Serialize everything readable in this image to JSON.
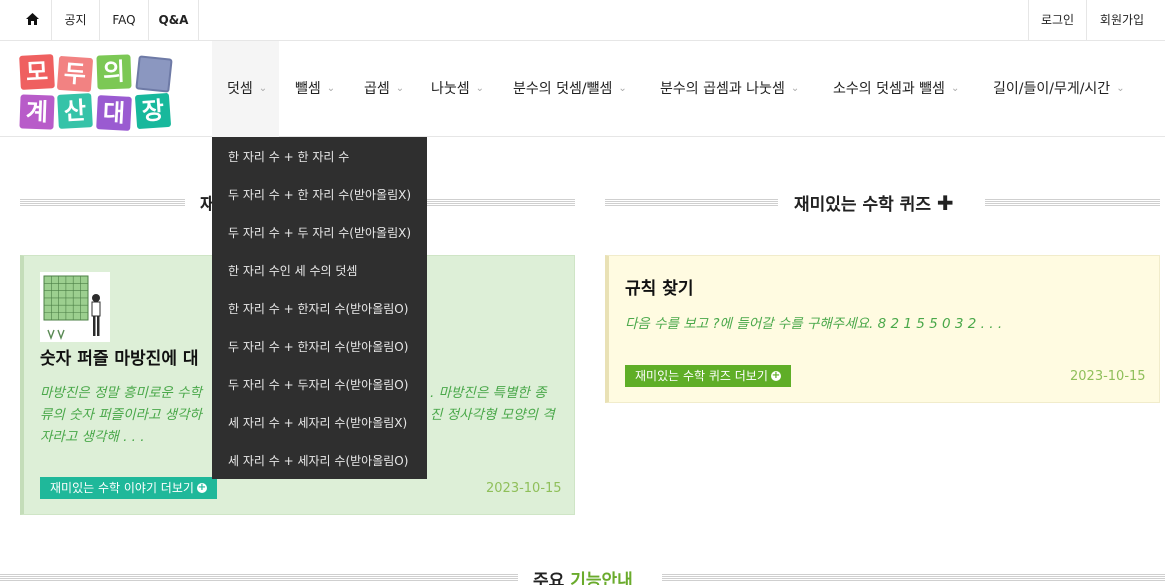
{
  "topbar": {
    "home_icon": "home-icon",
    "notice": "공지",
    "faq": "FAQ",
    "qna": "Q&A",
    "login": "로그인",
    "signup": "회원가입"
  },
  "logo": {
    "tiles": [
      "모",
      "두",
      "의",
      "",
      "계",
      "산",
      "대",
      "장"
    ]
  },
  "nav": {
    "items": [
      {
        "label": "덧셈"
      },
      {
        "label": "뺄셈"
      },
      {
        "label": "곱셈"
      },
      {
        "label": "나눗셈"
      },
      {
        "label": "분수의 덧셈/뺄셈"
      },
      {
        "label": "분수의 곱셈과 나눗셈"
      },
      {
        "label": "소수의 덧셈과 뺄셈"
      },
      {
        "label": "길이/들이/무게/시간"
      }
    ],
    "chevron_icon": "chevron-down-icon"
  },
  "dropdown": {
    "items": [
      "한 자리 수 + 한 자리 수",
      "두 자리 수 + 한 자리 수(받아올림X)",
      "두 자리 수 + 두 자리 수(받아올림X)",
      "한 자리 수인 세 수의 덧셈",
      "한 자리 수 + 한자리 수(받아올림O)",
      "두 자리 수 + 한자리 수(받아올림O)",
      "두 자리 수 + 두자리 수(받아올림O)",
      "세 자리 수 + 세자리 수(받아올림X)",
      "세 자리 수 + 세자리 수(받아올림O)"
    ]
  },
  "story_section": {
    "title": "재",
    "card": {
      "title": "숫자 퍼즐 마방진에 대",
      "desc_line1": "마방진은 정말 흥미로운 수학",
      "desc_line1_tail": ". 마방진은 특별한 종",
      "desc_line2": "류의 숫자 퍼즐이라고 생각하",
      "desc_line2_tail": "진 정사각형 모양의 격",
      "desc_line3": "자라고 생각해 . . .",
      "more": "재미있는 수학 이야기 더보기",
      "date": "2023-10-15"
    }
  },
  "quiz_section": {
    "title": "재미있는 수학 퀴즈",
    "title_icon": "plus-icon",
    "card": {
      "title": "규칙 찾기",
      "desc": "다음 수를 보고 ?에 들어갈 수를 구해주세요. 8 2 1 5 5 0 3 2 . . .",
      "more": "재미있는 수학 퀴즈 더보기",
      "date": "2023-10-15"
    }
  },
  "features_section": {
    "title_part1": "주요",
    "title_part2": "기능안내"
  },
  "colors": {
    "teal": "#1fb89a",
    "lime": "#5fae27",
    "dropdown_bg": "#2f2f2f",
    "green_card": "#ddefd7",
    "yellow_card": "#fffbe1"
  }
}
